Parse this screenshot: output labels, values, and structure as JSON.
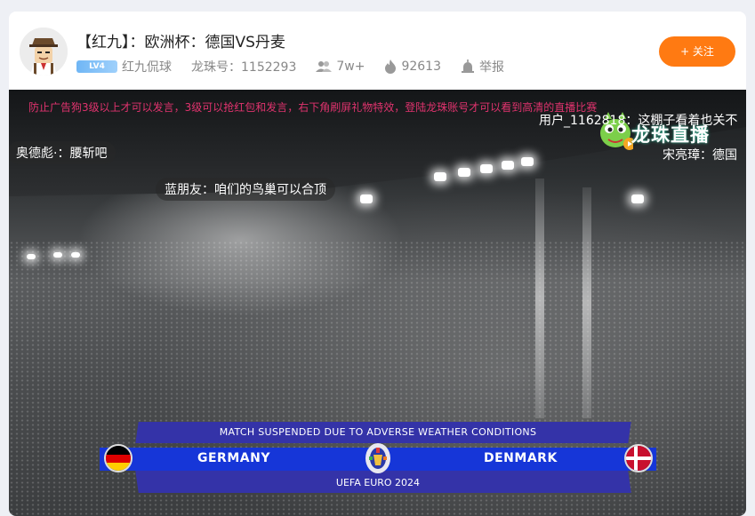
{
  "header": {
    "title": "【红九】：欧洲杯：德国VS丹麦",
    "level_badge": "LV4",
    "streamer_name": "红九侃球",
    "room_id": "龙珠号：1152293",
    "viewers": "7w+",
    "heat": "92613",
    "report": "举报",
    "follow_label": "+ 关注",
    "accent_color": "#ff7a12"
  },
  "video": {
    "notice": "防止广告狗3级以上才可以发言，3级可以抢红包和发言，右下角刷屏礼物特效，登陆龙珠账号才可以看到高清的直播比赛",
    "watermark": "龙珠直播",
    "danmu": [
      "用户_1162818：这棚子看着也关不",
      "奥德彪·：腰斩吧",
      "宋亮璋：德国",
      "蓝朋友：咱们的鸟巢可以合顶"
    ]
  },
  "scoreboard": {
    "status": "MATCH SUSPENDED DUE TO ADVERSE WEATHER CONDITIONS",
    "home_team": "GERMANY",
    "away_team": "DENMARK",
    "tournament": "UEFA EURO 2024"
  }
}
